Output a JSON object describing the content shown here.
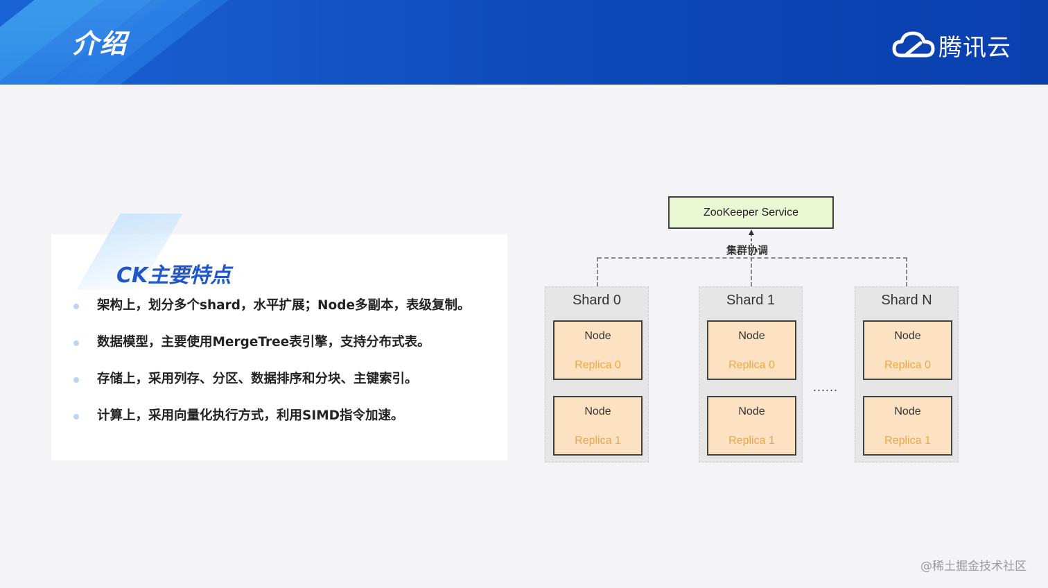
{
  "header": {
    "title": "介绍",
    "logo_text": "腾讯云"
  },
  "card": {
    "title": "CK主要特点",
    "bullets": [
      "架构上，划分多个shard，水平扩展；Node多副本，表级复制。",
      "数据模型，主要使用MergeTree表引擎，支持分布式表。",
      "存储上，采用列存、分区、数据排序和分块、主键索引。",
      "计算上，采用向量化执行方式，利用SIMD指令加速。"
    ]
  },
  "diagram": {
    "zookeeper": "ZooKeeper Service",
    "coord_label": "集群协调",
    "ellipsis": "......",
    "shards": [
      {
        "title": "Shard 0",
        "nodes": [
          {
            "label": "Node",
            "replica": "Replica 0"
          },
          {
            "label": "Node",
            "replica": "Replica 1"
          }
        ]
      },
      {
        "title": "Shard 1",
        "nodes": [
          {
            "label": "Node",
            "replica": "Replica 0"
          },
          {
            "label": "Node",
            "replica": "Replica 1"
          }
        ]
      },
      {
        "title": "Shard N",
        "nodes": [
          {
            "label": "Node",
            "replica": "Replica 0"
          },
          {
            "label": "Node",
            "replica": "Replica 1"
          }
        ]
      }
    ]
  },
  "watermark": "@稀土掘金技术社区",
  "colors": {
    "header_blue": "#0d49b8",
    "title_blue": "#1f57c8",
    "zk_fill": "#ebf6d3",
    "node_fill": "#fde1c3",
    "replica_text": "#f0a640"
  }
}
